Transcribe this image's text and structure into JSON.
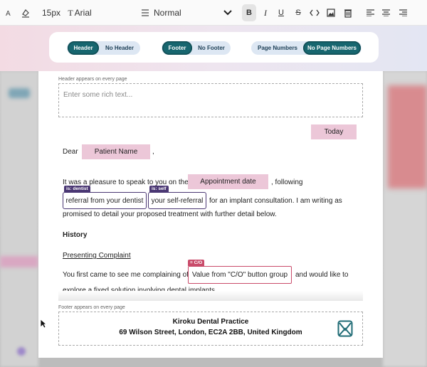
{
  "toolbar": {
    "font_size": "15px",
    "font_family": "Arial",
    "block_style": "Normal",
    "icons": [
      "text-size-icon",
      "highlight-icon",
      "font-icon",
      "paragraph-icon",
      "chevron-down-icon",
      "bold-icon",
      "italic-icon",
      "underline-icon",
      "strikethrough-icon",
      "code-icon",
      "image-icon",
      "trash-icon",
      "align-left-icon",
      "align-center-icon",
      "align-right-icon"
    ]
  },
  "options": {
    "header": {
      "on": "Header",
      "off": "No Header",
      "selected": "Header"
    },
    "footer": {
      "on": "Footer",
      "off": "No Footer",
      "selected": "Footer"
    },
    "page_numbers": {
      "on": "Page Numbers",
      "off": "No Page Numbers",
      "selected": "No Page Numbers"
    }
  },
  "document": {
    "header_label": "Header appears on every page",
    "header_placeholder": "Enter some rich text...",
    "today_chip": "Today",
    "dear": "Dear",
    "patient_name_chip": "Patient Name",
    "comma": ",",
    "line1_prefix": "It was a pleasure to speak to you on the",
    "appointment_chip": "Appointment date",
    "line1_suffix": ", following",
    "dentist_tag": "is: dentist",
    "dentist_chip": "referral from your dentist",
    "self_tag": "is: self",
    "self_chip": "your self-referral",
    "line2_suffix": "for an implant consultation. I am writing as",
    "line3": "promised to detail your proposed treatment with further detail below.",
    "history_heading": "History",
    "presenting_heading": "Presenting Complaint",
    "complaint_prefix": "You first came to see me complaining of",
    "co_tag": "C/O",
    "co_chip": "Value from \"C/O\" button group",
    "complaint_suffix": "and would like to",
    "complaint_line2": "explore a fixed solution involving dental implants.",
    "footer_label": "Footer appears on every page",
    "footer_line1": "Kiroku Dental Practice",
    "footer_line2": "69 Wilson Street, London, EC2A 2BB, United Kingdom"
  },
  "colors": {
    "accent_teal": "#17666f",
    "chip_pink": "#ecc7d8",
    "chip_red_border": "#c94b6a",
    "chip_purple_border": "#4a3773",
    "logo_teal": "#1f6b75"
  }
}
